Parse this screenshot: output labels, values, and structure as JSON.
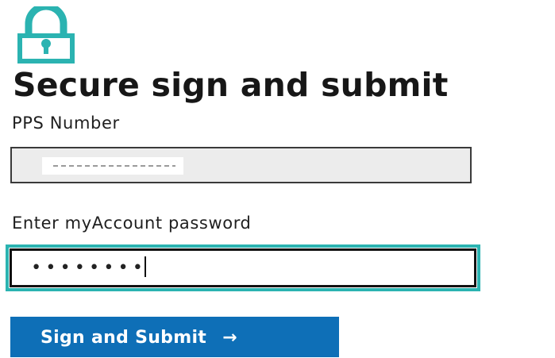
{
  "header": {
    "icon": "lock-icon",
    "title": "Secure sign and submit"
  },
  "form": {
    "pps_label": "PPS Number",
    "pps_value": "",
    "password_label": "Enter myAccount password",
    "password_value": "••••••••",
    "submit_label": "Sign and Submit",
    "submit_arrow": "→"
  },
  "colors": {
    "icon_teal": "#2bb3b1",
    "focus_ring": "#2bb3b1",
    "button_blue": "#0e6fb7"
  }
}
